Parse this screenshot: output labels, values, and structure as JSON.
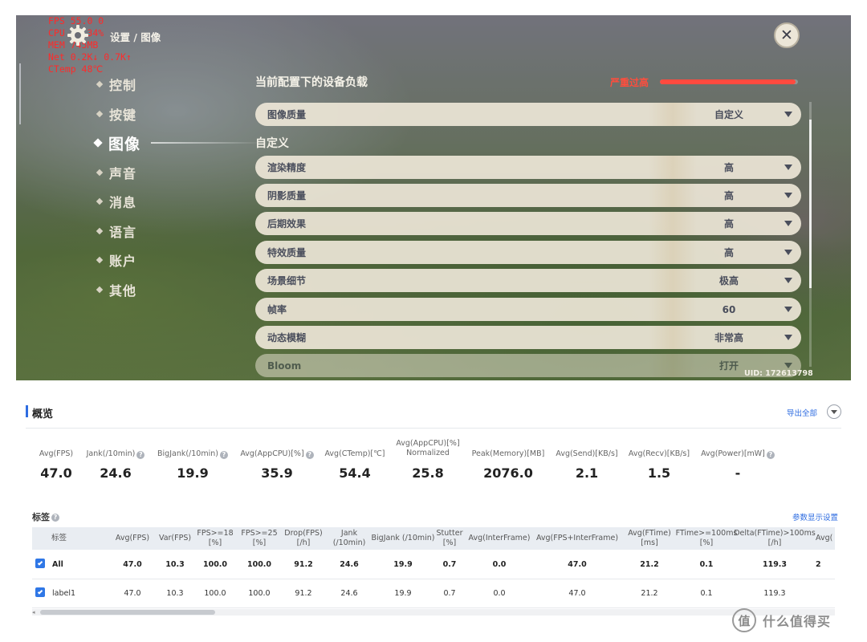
{
  "game": {
    "fps_overlay": [
      "FPS  55.0   0",
      "CPU  ?%  34%",
      "MEM  745MB",
      "Net   0.2K↓   0.7K↑",
      "CTemp  48℃"
    ],
    "breadcrumb": "设置 / 图像",
    "close_icon": "close-x",
    "nav_items": [
      "控制",
      "按键",
      "图像",
      "声音",
      "消息",
      "语言",
      "账户",
      "其他"
    ],
    "nav_active_index": 2,
    "panel_title": "当前配置下的设备负载",
    "load_label": "严重过高",
    "load_level": 0.98,
    "load_color": "#ff4a3f",
    "custom_heading": "自定义",
    "settings": [
      {
        "label": "图像质量",
        "value": "自定义"
      },
      {
        "label": "渲染精度",
        "value": "高"
      },
      {
        "label": "阴影质量",
        "value": "高"
      },
      {
        "label": "后期效果",
        "value": "高"
      },
      {
        "label": "特效质量",
        "value": "高"
      },
      {
        "label": "场景细节",
        "value": "极高"
      },
      {
        "label": "帧率",
        "value": "60"
      },
      {
        "label": "动态模糊",
        "value": "非常高"
      },
      {
        "label": "Bloom",
        "value": "打开"
      }
    ],
    "uid": "UID: 172613798"
  },
  "perf": {
    "overview_title": "概览",
    "export_all": "导出全部",
    "stats": [
      {
        "label": "Avg(FPS)",
        "value": "47.0",
        "help": false
      },
      {
        "label": "Jank(/10min)",
        "value": "24.6",
        "help": true
      },
      {
        "label": "BigJank(/10min)",
        "value": "19.9",
        "help": true
      },
      {
        "label": "Avg(AppCPU)[%]",
        "value": "35.9",
        "help": true
      },
      {
        "label": "Avg(CTemp)[℃]",
        "value": "54.4",
        "help": false
      },
      {
        "label": "Avg(AppCPU)[%] Normalized",
        "value": "25.8",
        "help": true
      },
      {
        "label": "Peak(Memory)[MB]",
        "value": "2076.0",
        "help": false
      },
      {
        "label": "Avg(Send)[KB/s]",
        "value": "2.1",
        "help": false
      },
      {
        "label": "Avg(Recv)[KB/s]",
        "value": "1.5",
        "help": false
      },
      {
        "label": "Avg(Power)[mW]",
        "value": "-",
        "help": true
      }
    ],
    "tags_title": "标签",
    "param_settings": "参数显示设置",
    "table": {
      "columns": [
        "标签",
        "Avg(FPS)",
        "Var(FPS)",
        "FPS>=18 [%]",
        "FPS>=25 [%]",
        "Drop(FPS) [/h]",
        "Jank (/10min)",
        "BigJank (/10min)",
        "Stutter [%]",
        "Avg(InterFrame)",
        "Avg(FPS+InterFrame)",
        "Avg(FTime) [ms]",
        "FTime>=100ms [%]",
        "Delta(FTime)>100ms [/h]",
        "Avg("
      ],
      "rows": [
        {
          "name": "All",
          "cells": [
            "47.0",
            "10.3",
            "100.0",
            "100.0",
            "91.2",
            "24.6",
            "19.9",
            "0.7",
            "0.0",
            "47.0",
            "21.2",
            "0.1",
            "119.3",
            "2"
          ]
        },
        {
          "name": "label1",
          "cells": [
            "47.0",
            "10.3",
            "100.0",
            "100.0",
            "91.2",
            "24.6",
            "19.9",
            "0.7",
            "0.0",
            "47.0",
            "21.2",
            "0.1",
            "119.3",
            ""
          ]
        }
      ]
    }
  },
  "watermark": {
    "logo": "值",
    "text": "什么值得买"
  }
}
